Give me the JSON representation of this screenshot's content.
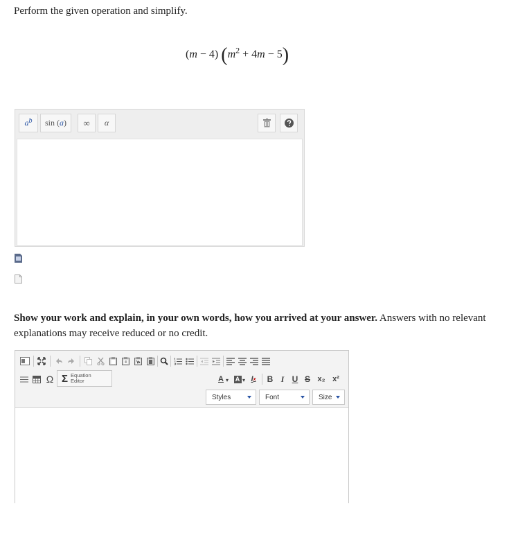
{
  "question": {
    "instruction": "Perform the given operation and simplify.",
    "expr": {
      "open1": "(",
      "m1": "m",
      "minus1": " − 4)",
      "open2": "(",
      "m2": "m",
      "exp": "2",
      "plus": " + 4",
      "m3": "m",
      "minus2": " − 5",
      "close2": ")"
    }
  },
  "math_toolbar": {
    "superscript_base": "a",
    "superscript_exp": "b",
    "sin_fn": "sin",
    "sin_arg": "a",
    "infinity": "∞",
    "alpha": "α"
  },
  "prompt": {
    "bold": "Show your work and explain, in your own words, how you arrived at your answer.",
    "rest": " Answers with no relevant explanations may receive reduced or no credit."
  },
  "rte": {
    "equation_editor_label_1": "Equation",
    "equation_editor_label_2": "Editor",
    "styles": "Styles",
    "font": "Font",
    "size": "Size",
    "bold": "B",
    "italic": "I",
    "underline": "U",
    "strike": "S",
    "sub": "x₂",
    "sup": "x²",
    "omega": "Ω",
    "sigma": "Σ",
    "font_color": "A",
    "bg_color": "A",
    "remove_format": "I"
  },
  "colors": {
    "accent": "#2a55a5",
    "toolbar_bg": "#f3f3f3"
  }
}
